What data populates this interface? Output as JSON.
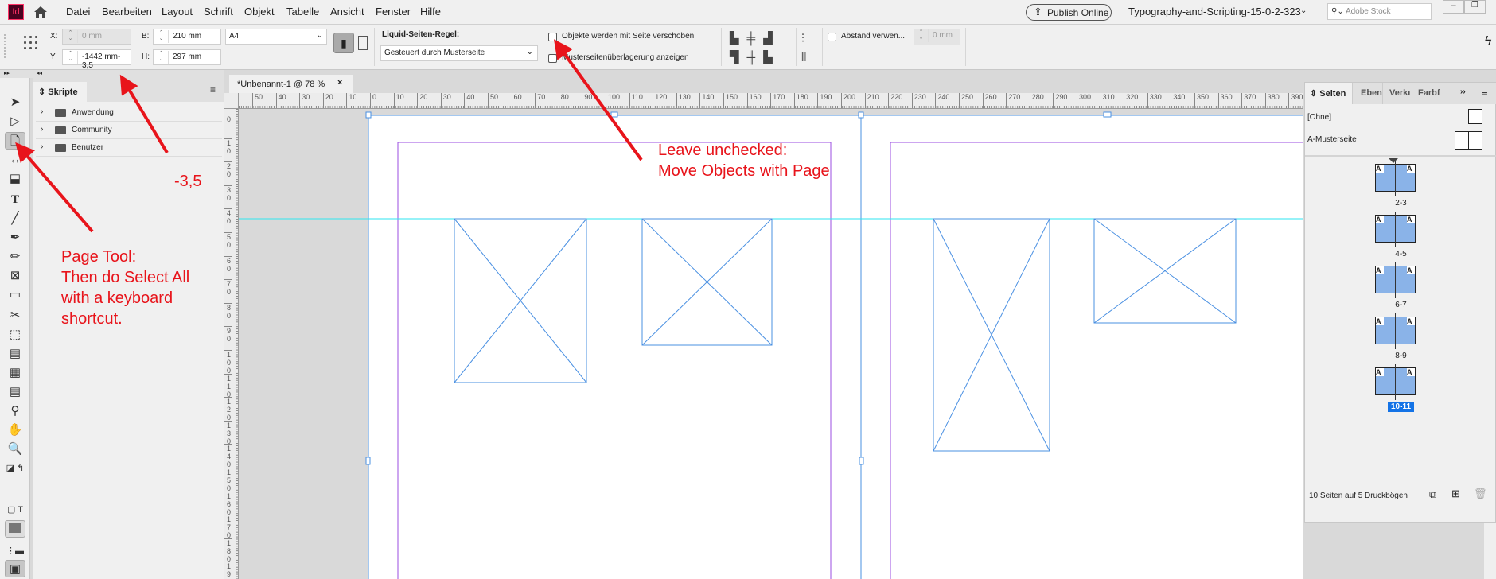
{
  "app": {
    "logo": "Id",
    "home_icon": "home-icon"
  },
  "menu": [
    "Datei",
    "Bearbeiten",
    "Layout",
    "Schrift",
    "Objekt",
    "Tabelle",
    "Ansicht",
    "Fenster",
    "Hilfe"
  ],
  "topright": {
    "publish": "Publish Online",
    "doc_name": "Typography-and-Scripting-15-0-2-323",
    "search_placeholder": "Adobe Stock"
  },
  "control": {
    "x_label": "X:",
    "x_value": "0 mm",
    "y_label": "Y:",
    "y_value": "-1442 mm-3,5",
    "b_label": "B:",
    "b_value": "210 mm",
    "h_label": "H:",
    "h_value": "297 mm",
    "size_preset": "A4",
    "liquid_label": "Liquid-Seiten-Regel:",
    "liquid_value": "Gesteuert durch Musterseite",
    "cb_move": "Objekte werden mit Seite verschoben",
    "cb_overlay": "Musterseitenüberlagerung anzeigen",
    "spacing_label": "Abstand verwen...",
    "spacing_value": "0 mm"
  },
  "scripts": {
    "title": "Skripte",
    "items": [
      "Anwendung",
      "Community",
      "Benutzer"
    ]
  },
  "doc_tab": {
    "title": "*Unbenannt-1 @ 78 %",
    "close": "×"
  },
  "rulers": {
    "h": [
      "50",
      "40",
      "30",
      "20",
      "10",
      "0",
      "10",
      "20",
      "30",
      "40",
      "50",
      "60",
      "70",
      "80",
      "90",
      "100",
      "110",
      "120",
      "130",
      "140",
      "150",
      "160",
      "170",
      "180",
      "190",
      "200",
      "210",
      "220",
      "230",
      "240",
      "250",
      "260",
      "270",
      "280",
      "290",
      "300",
      "310",
      "320",
      "330",
      "340",
      "350",
      "360",
      "370",
      "380",
      "390"
    ],
    "v": [
      "0",
      "10",
      "20",
      "30",
      "40",
      "50",
      "60",
      "70",
      "80",
      "90",
      "100",
      "110",
      "120",
      "130",
      "140",
      "150",
      "160",
      "170",
      "180",
      "190"
    ]
  },
  "pages_panel": {
    "tabs": [
      "Seiten",
      "Eben",
      "Verkı",
      "Farbf"
    ],
    "masters": [
      "[Ohne]",
      "A-Musterseite"
    ],
    "spreads": [
      "2-3",
      "4-5",
      "6-7",
      "8-9",
      "10-11"
    ],
    "selected": "10-11",
    "footer": "10 Seiten auf 5 Druckbögen",
    "master_letter": "A"
  },
  "annotations": {
    "page_tool": [
      "Page Tool:",
      "Then do Select All",
      "with a keyboard",
      "shortcut."
    ],
    "value": "-3,5",
    "unchecked": [
      "Leave unchecked:",
      "Move Objects with Page"
    ],
    "color": "#e8141b"
  }
}
